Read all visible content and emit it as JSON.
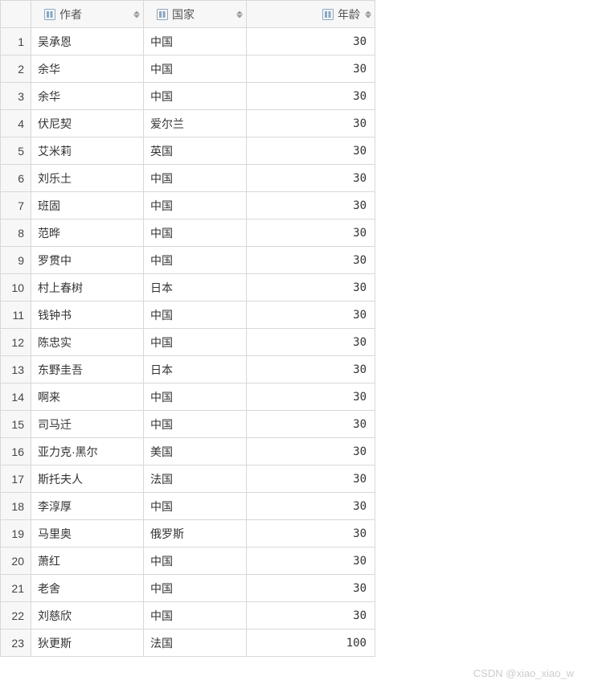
{
  "columns": [
    {
      "key": "author",
      "label": "作者"
    },
    {
      "key": "country",
      "label": "国家"
    },
    {
      "key": "age",
      "label": "年龄"
    }
  ],
  "rows": [
    {
      "n": "1",
      "author": "吴承恩",
      "country": "中国",
      "age": "30"
    },
    {
      "n": "2",
      "author": "余华",
      "country": "中国",
      "age": "30"
    },
    {
      "n": "3",
      "author": "余华",
      "country": "中国",
      "age": "30"
    },
    {
      "n": "4",
      "author": "伏尼契",
      "country": "爱尔兰",
      "age": "30"
    },
    {
      "n": "5",
      "author": "艾米莉",
      "country": "英国",
      "age": "30"
    },
    {
      "n": "6",
      "author": "刘乐土",
      "country": "中国",
      "age": "30"
    },
    {
      "n": "7",
      "author": "班固",
      "country": "中国",
      "age": "30"
    },
    {
      "n": "8",
      "author": "范晔",
      "country": "中国",
      "age": "30"
    },
    {
      "n": "9",
      "author": "罗贯中",
      "country": "中国",
      "age": "30"
    },
    {
      "n": "10",
      "author": "村上春树",
      "country": "日本",
      "age": "30"
    },
    {
      "n": "11",
      "author": "钱钟书",
      "country": "中国",
      "age": "30"
    },
    {
      "n": "12",
      "author": "陈忠实",
      "country": "中国",
      "age": "30"
    },
    {
      "n": "13",
      "author": "东野圭吾",
      "country": "日本",
      "age": "30"
    },
    {
      "n": "14",
      "author": "啊来",
      "country": "中国",
      "age": "30"
    },
    {
      "n": "15",
      "author": "司马迁",
      "country": "中国",
      "age": "30"
    },
    {
      "n": "16",
      "author": "亚力克·黑尔",
      "country": "美国",
      "age": "30"
    },
    {
      "n": "17",
      "author": "斯托夫人",
      "country": "法国",
      "age": "30"
    },
    {
      "n": "18",
      "author": "李淳厚",
      "country": "中国",
      "age": "30"
    },
    {
      "n": "19",
      "author": "马里奥",
      "country": "俄罗斯",
      "age": "30"
    },
    {
      "n": "20",
      "author": "萧红",
      "country": "中国",
      "age": "30"
    },
    {
      "n": "21",
      "author": "老舍",
      "country": "中国",
      "age": "30"
    },
    {
      "n": "22",
      "author": "刘慈欣",
      "country": "中国",
      "age": "30"
    },
    {
      "n": "23",
      "author": "狄更斯",
      "country": "法国",
      "age": "100"
    }
  ],
  "watermark": "CSDN @xiao_xiao_w"
}
